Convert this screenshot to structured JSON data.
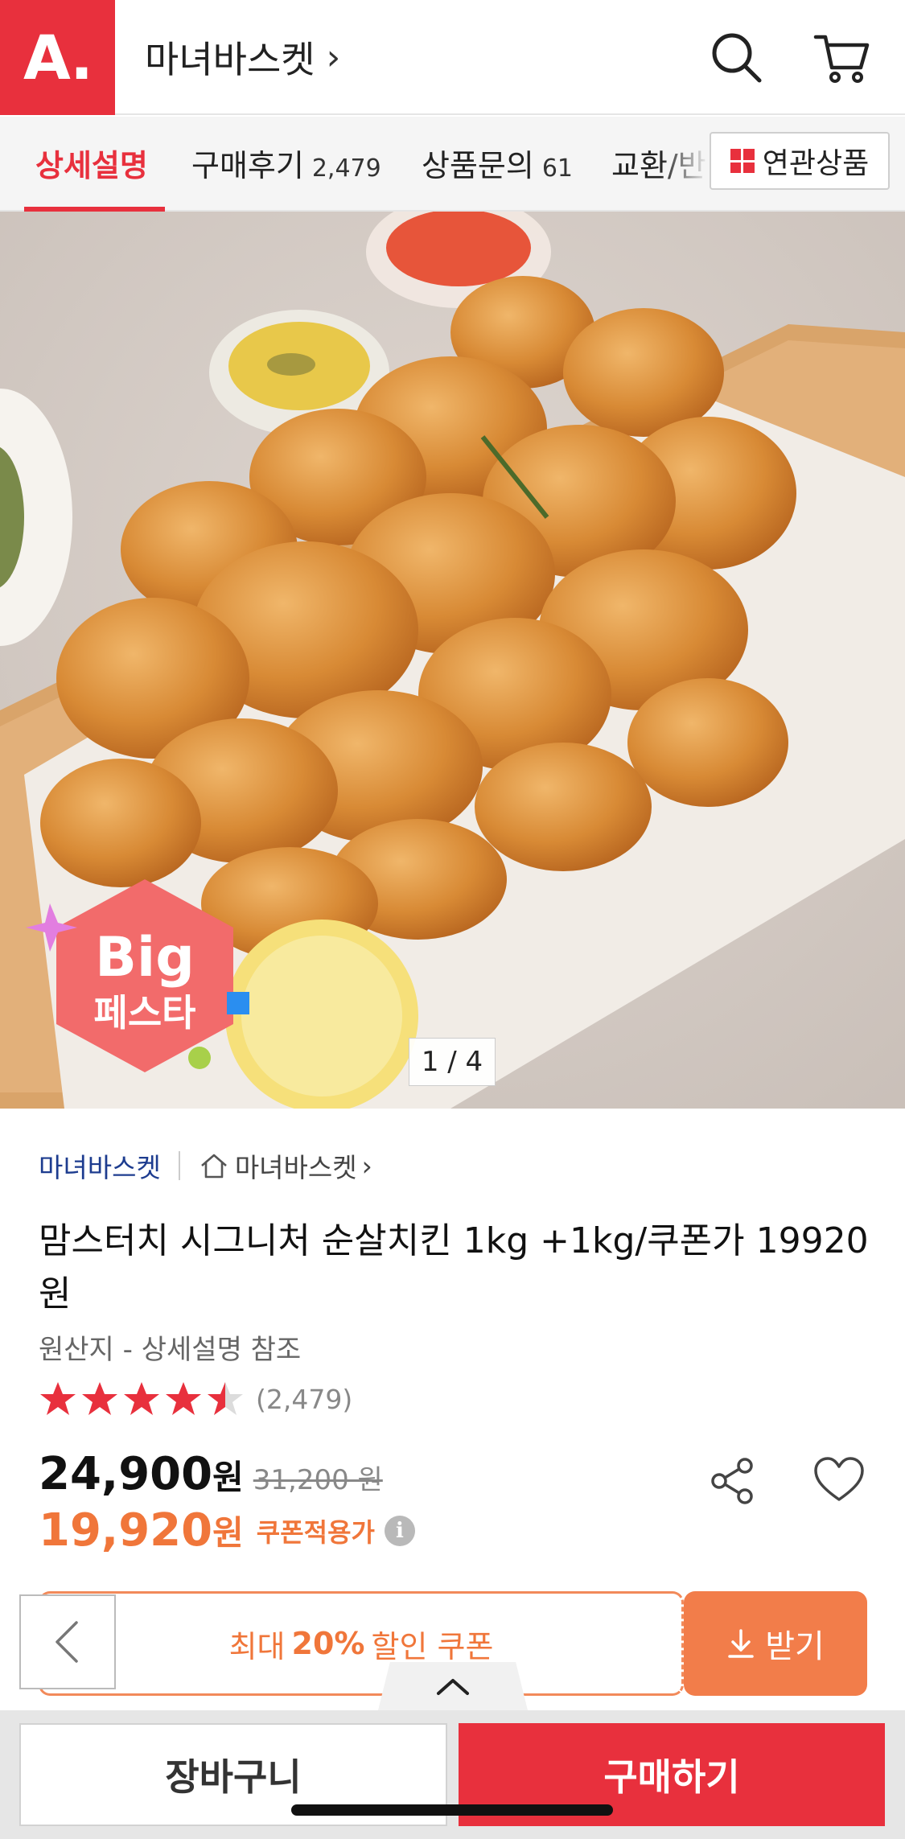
{
  "header": {
    "logo": "A.",
    "store_name": "마녀바스켓",
    "chevron": "›",
    "icons": [
      "search-icon",
      "cart-icon"
    ]
  },
  "tabs": [
    {
      "label": "상세설명",
      "count": "",
      "active": true
    },
    {
      "label": "구매후기",
      "count": "2,479",
      "active": false
    },
    {
      "label": "상품문의",
      "count": "61",
      "active": false
    },
    {
      "label": "교환/반",
      "count": "",
      "active": false
    }
  ],
  "related_button": {
    "label": "연관상품"
  },
  "image": {
    "counter": "1 / 4",
    "badge_top": "Big",
    "badge_bottom": "페스타"
  },
  "brand": {
    "name": "마녀바스켓",
    "store": "마녀바스켓",
    "store_chevron": "›"
  },
  "product": {
    "title": "맘스터치 시그니처 순살치킨 1kg +1kg/쿠폰가 19920원",
    "origin": "원산지 - 상세설명 참조",
    "rating": 4.5,
    "review_count": "(2,479)"
  },
  "price": {
    "current": "24,900",
    "unit": "원",
    "original": "31,200 원",
    "coupon_price": "19,920",
    "coupon_unit": "원",
    "coupon_label": "쿠폰적용가",
    "info_glyph": "i"
  },
  "coupon": {
    "prefix": "최대",
    "percent": "20%",
    "suffix": "할인 쿠폰",
    "get_label": "받기"
  },
  "bottom": {
    "cart_label": "장바구니",
    "buy_label": "구매하기"
  },
  "colors": {
    "brand_red": "#e8303d",
    "coupon_orange": "#f0763a",
    "star": "#e8303d"
  }
}
